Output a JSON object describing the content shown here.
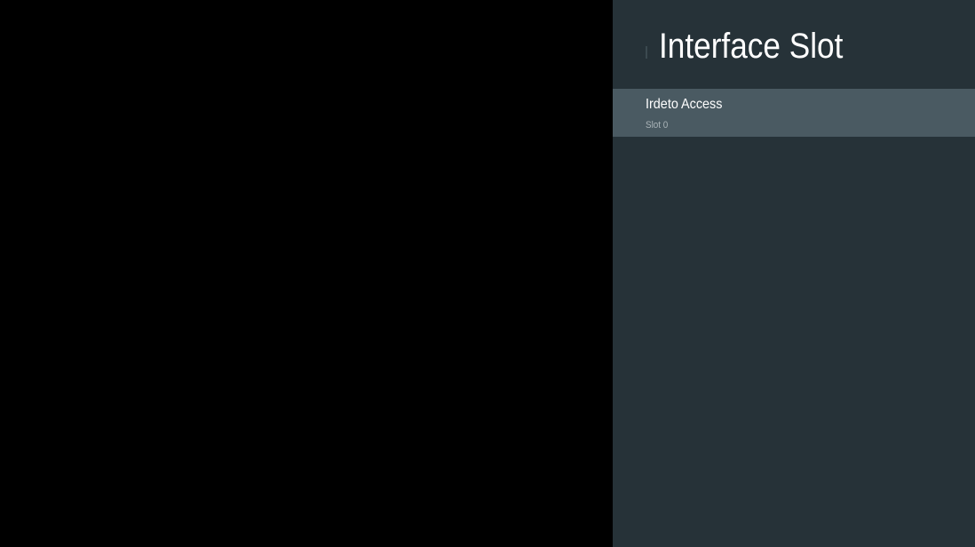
{
  "panel": {
    "title": "Interface Slot",
    "items": [
      {
        "title": "Irdeto Access",
        "subtitle": "Slot 0",
        "selected": true
      }
    ]
  },
  "colors": {
    "video_background": "#000000",
    "panel_background": "#263238",
    "selected_item_background": "#4a5a62",
    "primary_text": "#ffffff",
    "secondary_text": "#aab4b8"
  }
}
